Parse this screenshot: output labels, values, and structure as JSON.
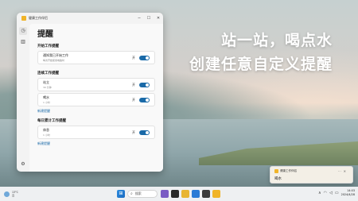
{
  "desktop": {
    "headline_1": "站一站，喝点水",
    "headline_2": "创建任意自定义提醒"
  },
  "app": {
    "window_title": "健康工作伴侣",
    "page_title": "提醒",
    "sections": [
      {
        "title": "开始工作提醒",
        "items": [
          {
            "name": "通知我已开始工作",
            "sub": "每次开始使用电脑时",
            "toggle": "开"
          }
        ],
        "add": ""
      },
      {
        "title": "连续工作提醒",
        "items": [
          {
            "name": "站立",
            "sub": "30 分钟",
            "toggle": "开"
          },
          {
            "name": "喝水",
            "sub": "1 小时",
            "toggle": "开"
          }
        ],
        "add": "新建提醒"
      },
      {
        "title": "每日累计工作提醒",
        "items": [
          {
            "name": "休息",
            "sub": "1 小时",
            "toggle": "开"
          }
        ],
        "add": "新建提醒"
      }
    ]
  },
  "notification": {
    "app": "健康工作伴侣",
    "message": "喝水"
  },
  "taskbar": {
    "weather_temp": "13°C",
    "weather_desc": "云",
    "search_placeholder": "搜索",
    "time": "14:03",
    "date": "2024/4/28"
  },
  "colors": {
    "accent": "#1a6aa8",
    "app_logo": "#f0b429"
  }
}
